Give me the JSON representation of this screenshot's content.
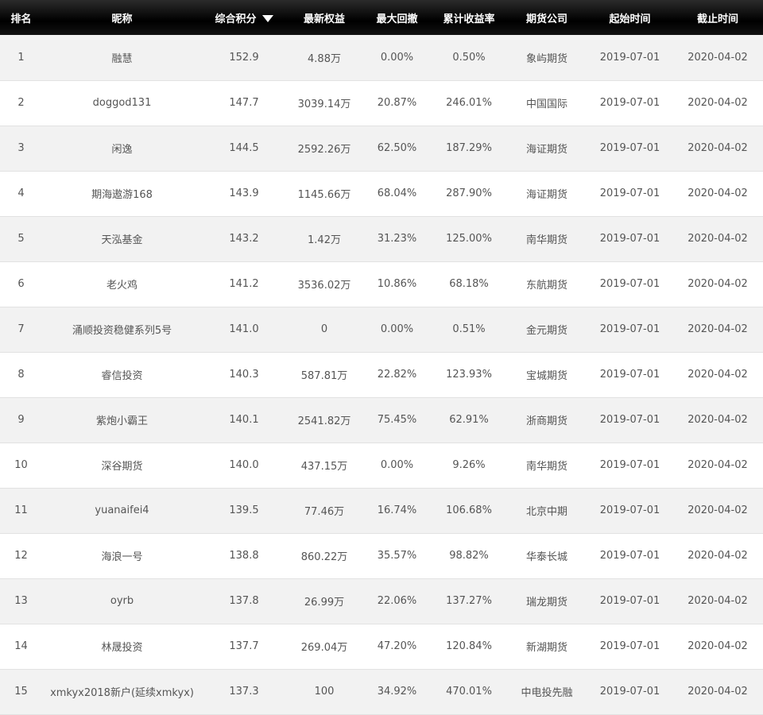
{
  "table": {
    "headers": {
      "rank": "排名",
      "nickname": "昵称",
      "score": "综合积分",
      "equity": "最新权益",
      "drawdown": "最大回撤",
      "return_rate": "累计收益率",
      "broker": "期货公司",
      "start": "起始时间",
      "end": "截止时间"
    },
    "sort": {
      "column": "score",
      "direction": "descending",
      "icon": "sort-desc-triangle-icon"
    },
    "rows": [
      {
        "rank": "1",
        "nickname": "融慧",
        "score": "152.9",
        "equity": "4.88万",
        "drawdown": "0.00%",
        "return_rate": "0.50%",
        "broker": "象屿期货",
        "start": "2019-07-01",
        "end": "2020-04-02"
      },
      {
        "rank": "2",
        "nickname": "doggod131",
        "score": "147.7",
        "equity": "3039.14万",
        "drawdown": "20.87%",
        "return_rate": "246.01%",
        "broker": "中国国际",
        "start": "2019-07-01",
        "end": "2020-04-02"
      },
      {
        "rank": "3",
        "nickname": "闲逸",
        "score": "144.5",
        "equity": "2592.26万",
        "drawdown": "62.50%",
        "return_rate": "187.29%",
        "broker": "海证期货",
        "start": "2019-07-01",
        "end": "2020-04-02"
      },
      {
        "rank": "4",
        "nickname": "期海遨游168",
        "score": "143.9",
        "equity": "1145.66万",
        "drawdown": "68.04%",
        "return_rate": "287.90%",
        "broker": "海证期货",
        "start": "2019-07-01",
        "end": "2020-04-02"
      },
      {
        "rank": "5",
        "nickname": "天泓基金",
        "score": "143.2",
        "equity": "1.42万",
        "drawdown": "31.23%",
        "return_rate": "125.00%",
        "broker": "南华期货",
        "start": "2019-07-01",
        "end": "2020-04-02"
      },
      {
        "rank": "6",
        "nickname": "老火鸡",
        "score": "141.2",
        "equity": "3536.02万",
        "drawdown": "10.86%",
        "return_rate": "68.18%",
        "broker": "东航期货",
        "start": "2019-07-01",
        "end": "2020-04-02"
      },
      {
        "rank": "7",
        "nickname": "涌顺投资稳健系列5号",
        "score": "141.0",
        "equity": "0",
        "drawdown": "0.00%",
        "return_rate": "0.51%",
        "broker": "金元期货",
        "start": "2019-07-01",
        "end": "2020-04-02"
      },
      {
        "rank": "8",
        "nickname": "睿信投资",
        "score": "140.3",
        "equity": "587.81万",
        "drawdown": "22.82%",
        "return_rate": "123.93%",
        "broker": "宝城期货",
        "start": "2019-07-01",
        "end": "2020-04-02"
      },
      {
        "rank": "9",
        "nickname": "紫炮小霸王",
        "score": "140.1",
        "equity": "2541.82万",
        "drawdown": "75.45%",
        "return_rate": "62.91%",
        "broker": "浙商期货",
        "start": "2019-07-01",
        "end": "2020-04-02"
      },
      {
        "rank": "10",
        "nickname": "深谷期货",
        "score": "140.0",
        "equity": "437.15万",
        "drawdown": "0.00%",
        "return_rate": "9.26%",
        "broker": "南华期货",
        "start": "2019-07-01",
        "end": "2020-04-02"
      },
      {
        "rank": "11",
        "nickname": "yuanaifei4",
        "score": "139.5",
        "equity": "77.46万",
        "drawdown": "16.74%",
        "return_rate": "106.68%",
        "broker": "北京中期",
        "start": "2019-07-01",
        "end": "2020-04-02"
      },
      {
        "rank": "12",
        "nickname": "海浪一号",
        "score": "138.8",
        "equity": "860.22万",
        "drawdown": "35.57%",
        "return_rate": "98.82%",
        "broker": "华泰长城",
        "start": "2019-07-01",
        "end": "2020-04-02"
      },
      {
        "rank": "13",
        "nickname": "oyrb",
        "score": "137.8",
        "equity": "26.99万",
        "drawdown": "22.06%",
        "return_rate": "137.27%",
        "broker": "瑞龙期货",
        "start": "2019-07-01",
        "end": "2020-04-02"
      },
      {
        "rank": "14",
        "nickname": "林晟投资",
        "score": "137.7",
        "equity": "269.04万",
        "drawdown": "47.20%",
        "return_rate": "120.84%",
        "broker": "新湖期货",
        "start": "2019-07-01",
        "end": "2020-04-02"
      },
      {
        "rank": "15",
        "nickname": "xmkyx2018新户(延续xmkyx)",
        "score": "137.3",
        "equity": "100",
        "drawdown": "34.92%",
        "return_rate": "470.01%",
        "broker": "中电投先融",
        "start": "2019-07-01",
        "end": "2020-04-02"
      }
    ]
  },
  "colors": {
    "header_bg": "#000000",
    "header_text": "#ffffff",
    "row_odd": "#f2f2f2",
    "row_even": "#ffffff",
    "cell_text": "#555555"
  }
}
